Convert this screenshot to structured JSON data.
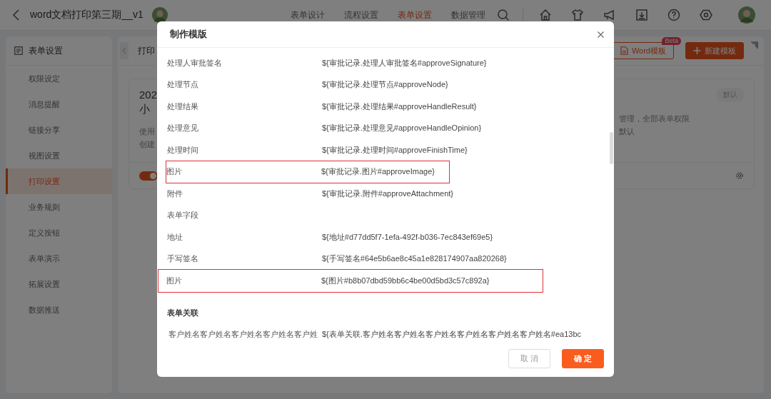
{
  "app_bar": {
    "title": "word文档打印第三期__v1",
    "nav_tabs": [
      {
        "label": "表单设计",
        "selected": false
      },
      {
        "label": "流程设置",
        "selected": false
      },
      {
        "label": "表单设置",
        "selected": true
      },
      {
        "label": "数据管理",
        "selected": false
      }
    ]
  },
  "sidebar": {
    "title": "表单设置",
    "items": [
      {
        "label": "权限设定",
        "selected": false
      },
      {
        "label": "消息提醒",
        "selected": false
      },
      {
        "label": "链接分享",
        "selected": false
      },
      {
        "label": "视图设置",
        "selected": false
      },
      {
        "label": "打印设置",
        "selected": true
      },
      {
        "label": "业务规则",
        "selected": false
      },
      {
        "label": "定义按钮",
        "selected": false
      },
      {
        "label": "表单演示",
        "selected": false
      },
      {
        "label": "拓展设置",
        "selected": false
      },
      {
        "label": "数据推送",
        "selected": false
      }
    ]
  },
  "main": {
    "breadcrumb": "打印",
    "buttons": [
      {
        "kind": "outline",
        "label": "Word模板",
        "badge": "Beta"
      },
      {
        "kind": "primary",
        "label": "新建模板"
      }
    ],
    "template_card": {
      "title": "202",
      "subtitle": "小",
      "tag": "默认",
      "desc_left": [
        "使用",
        "创建"
      ],
      "desc_right": [
        "管理，全部表单权限",
        "默认"
      ],
      "enabled": true
    }
  },
  "dialog": {
    "title": "制作模版",
    "rows": [
      {
        "kind": "field",
        "label": "处理人审批签名",
        "value": "${审批记录.处理人审批签名#approveSignature}",
        "highlighted": false
      },
      {
        "kind": "field",
        "label": "处理节点",
        "value": "${审批记录.处理节点#approveNode}",
        "highlighted": false
      },
      {
        "kind": "field",
        "label": "处理结果",
        "value": "${审批记录.处理结果#approveHandleResult}",
        "highlighted": false
      },
      {
        "kind": "field",
        "label": "处理意见",
        "value": "${审批记录.处理意见#approveHandleOpinion}",
        "highlighted": false
      },
      {
        "kind": "field",
        "label": "处理时间",
        "value": "${审批记录.处理时间#approveFinishTime}",
        "highlighted": false
      },
      {
        "kind": "field",
        "label": "图片",
        "value": "${审批记录.图片#approveImage}",
        "highlighted": true
      },
      {
        "kind": "field",
        "label": "附件",
        "value": "${审批记录.附件#approveAttachment}",
        "highlighted": false
      },
      {
        "kind": "group",
        "label": "表单字段"
      },
      {
        "kind": "field",
        "label": "地址",
        "value": "${地址#d77dd5f7-1efa-492f-b036-7ec843ef69e5}",
        "highlighted": false
      },
      {
        "kind": "field",
        "label": "手写签名",
        "value": "${手写签名#64e5b6ae8c45a1e828174907aa820268}",
        "highlighted": false
      },
      {
        "kind": "field",
        "label": "图片",
        "value": "${图片#b8b07dbd59bb6c4be00d5bd3c57c892a}",
        "highlighted": true
      },
      {
        "kind": "section",
        "label": "表单关联"
      },
      {
        "kind": "subfield",
        "label": "客户姓名客户姓名客户姓名客户姓名客户姓",
        "value": "${表单关联.客户姓名客户姓名客户姓名客户姓名客户姓名客户姓名#ea13bc",
        "highlighted": false
      }
    ],
    "buttons": [
      {
        "kind": "secondary",
        "label": "取 消"
      },
      {
        "kind": "primary",
        "label": "确 定"
      }
    ]
  }
}
